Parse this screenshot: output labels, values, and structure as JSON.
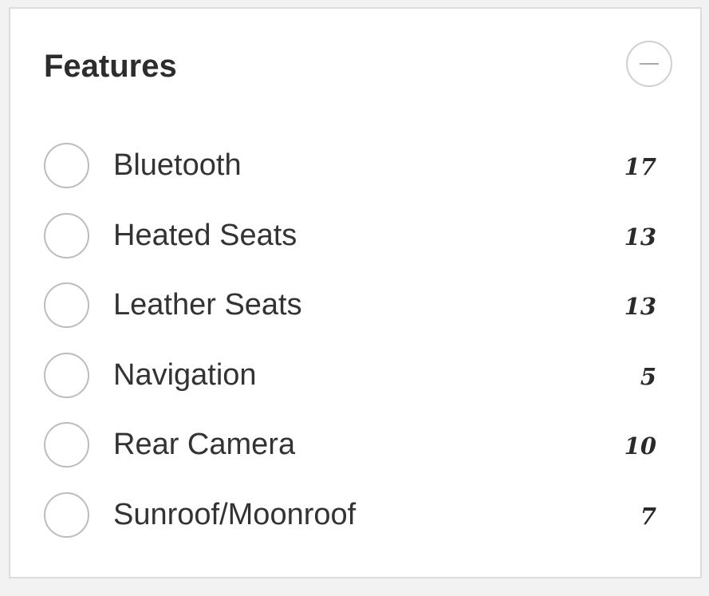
{
  "filter": {
    "title": "Features",
    "collapse_icon": "minus-icon",
    "options": [
      {
        "label": "Bluetooth",
        "count": "17",
        "selected": false
      },
      {
        "label": "Heated Seats",
        "count": "13",
        "selected": false
      },
      {
        "label": "Leather Seats",
        "count": "13",
        "selected": false
      },
      {
        "label": "Navigation",
        "count": "5",
        "selected": false
      },
      {
        "label": "Rear Camera",
        "count": "10",
        "selected": false
      },
      {
        "label": "Sunroof/Moonroof",
        "count": "7",
        "selected": false
      }
    ]
  },
  "colors": {
    "panel_border": "#dcdcdc",
    "title": "#2d2d2d",
    "radio_border": "#bdbdbd",
    "label": "#333333",
    "count": "#2a2a2a"
  }
}
